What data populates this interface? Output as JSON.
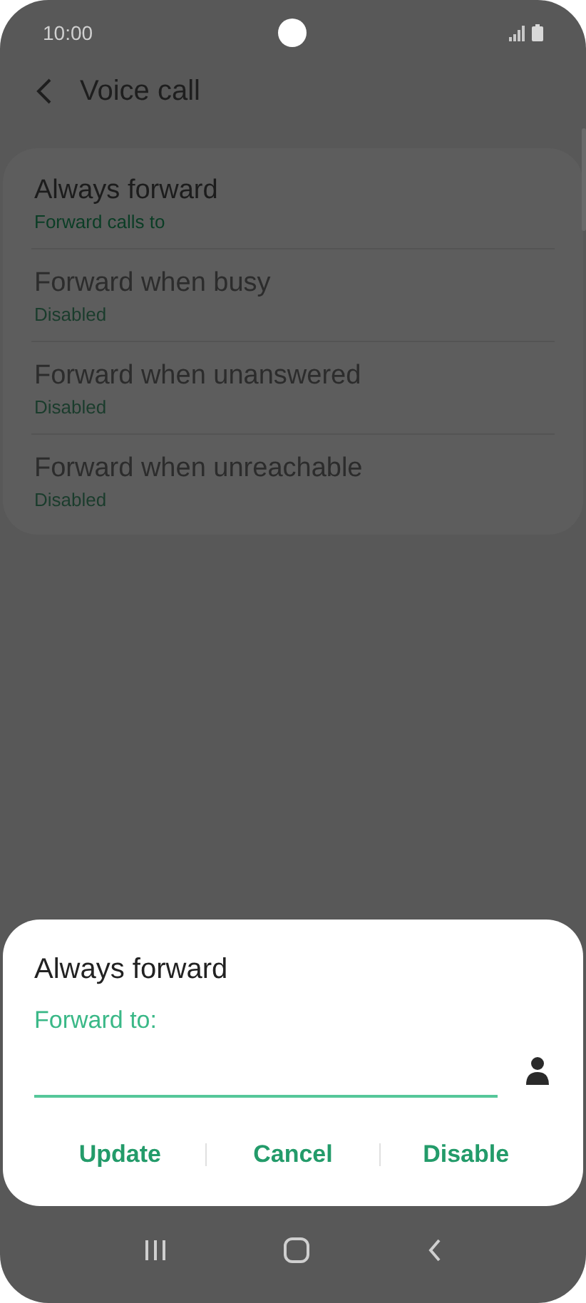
{
  "status_bar": {
    "time": "10:00"
  },
  "header": {
    "title": "Voice call"
  },
  "settings": [
    {
      "title": "Always forward",
      "summary": "Forward calls to",
      "disabled": false
    },
    {
      "title": "Forward when busy",
      "summary": "Disabled",
      "disabled": true
    },
    {
      "title": "Forward when unanswered",
      "summary": "Disabled",
      "disabled": true
    },
    {
      "title": "Forward when unreachable",
      "summary": "Disabled",
      "disabled": true
    }
  ],
  "dialog": {
    "title": "Always forward",
    "field_label": "Forward to:",
    "buttons": [
      "Update",
      "Cancel",
      "Disable"
    ]
  }
}
